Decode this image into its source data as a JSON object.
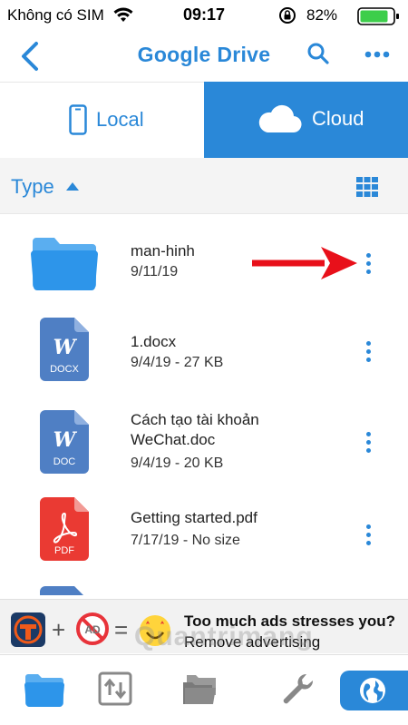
{
  "status_bar": {
    "carrier": "Không có SIM",
    "time": "09:17",
    "battery_percent": "82%"
  },
  "nav": {
    "title": "Google Drive"
  },
  "tabs": {
    "local_label": "Local",
    "cloud_label": "Cloud",
    "selected": "Cloud"
  },
  "sort": {
    "label": "Type"
  },
  "files": [
    {
      "name": "man-hinh",
      "meta": "9/11/19",
      "kind": "folder",
      "icon": "folder-icon"
    },
    {
      "name": "1.docx",
      "meta": "9/4/19 - 27 KB",
      "kind": "docx",
      "badge": "DOCX",
      "icon": "word-doc-icon"
    },
    {
      "name": "Cách tạo tài khoản WeChat.doc",
      "meta": "9/4/19 - 20 KB",
      "kind": "doc",
      "badge": "DOC",
      "icon": "word-doc-icon"
    },
    {
      "name": "Getting started.pdf",
      "meta": "7/17/19 - No size",
      "kind": "pdf",
      "badge": "PDF",
      "icon": "pdf-icon"
    }
  ],
  "ad": {
    "headline": "Too much ads stresses you?",
    "subline": "Remove advertising",
    "no_ad_label": "AD"
  },
  "watermark": "Quantrimang",
  "colors": {
    "accent": "#2a88d8",
    "folder": "#2d95ea",
    "word": "#4f7fc4",
    "pdf": "#ea3a33",
    "annotation_arrow": "#e8101a"
  }
}
